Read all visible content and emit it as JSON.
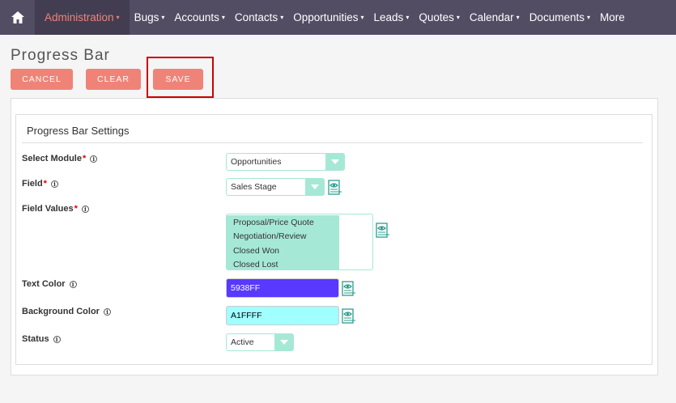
{
  "nav": {
    "items": [
      {
        "label": "Administration",
        "active": true
      },
      {
        "label": "Bugs"
      },
      {
        "label": "Accounts"
      },
      {
        "label": "Contacts"
      },
      {
        "label": "Opportunities"
      },
      {
        "label": "Leads"
      },
      {
        "label": "Quotes"
      },
      {
        "label": "Calendar"
      },
      {
        "label": "Documents"
      },
      {
        "label": "More"
      }
    ],
    "caret": "▾"
  },
  "page": {
    "title": "Progress Bar"
  },
  "actions": {
    "cancel": "CANCEL",
    "clear": "CLEAR",
    "save": "SAVE"
  },
  "panel": {
    "heading": "Progress Bar Settings"
  },
  "form": {
    "module_label": "Select Module",
    "module_value": "Opportunities",
    "field_label": "Field",
    "field_value": "Sales Stage",
    "values_label": "Field Values",
    "values_options": [
      "Proposal/Price Quote",
      "Negotiation/Review",
      "Closed Won",
      "Closed Lost"
    ],
    "text_color_label": "Text Color",
    "text_color_value": "5938FF",
    "bg_color_label": "Background Color",
    "bg_color_value": "A1FFFF",
    "status_label": "Status",
    "status_value": "Active",
    "required_mark": "*",
    "info_glyph": "i"
  },
  "colors": {
    "accent": "#f08377",
    "nav_bg": "#534d64",
    "select_accent": "#a5e8d6",
    "text_color_swatch": "#5938FF",
    "bg_color_swatch": "#A1FFFF"
  }
}
